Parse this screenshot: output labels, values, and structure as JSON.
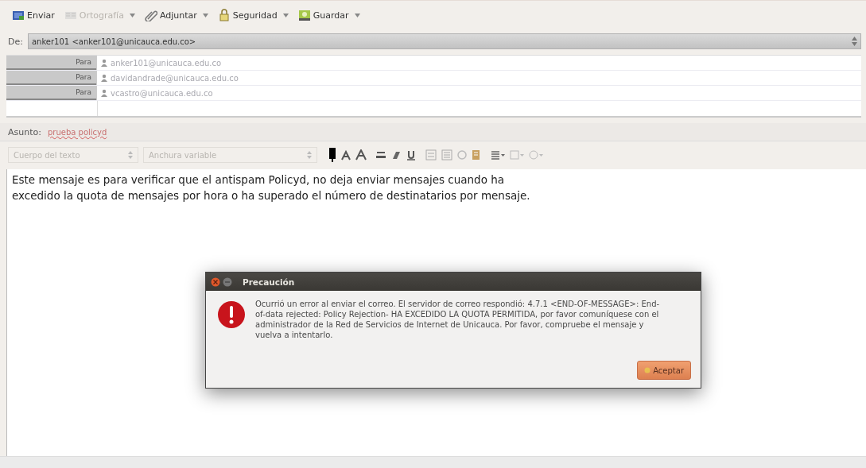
{
  "toolbar": {
    "buttons": [
      {
        "label": "Enviar",
        "disabled": false,
        "dropdown": false
      },
      {
        "label": "Ortografía",
        "disabled": true,
        "dropdown": true
      },
      {
        "label": "Adjuntar",
        "disabled": false,
        "dropdown": true
      },
      {
        "label": "Seguridad",
        "disabled": false,
        "dropdown": true
      },
      {
        "label": "Guardar",
        "disabled": false,
        "dropdown": true
      }
    ]
  },
  "from": {
    "label": "De:",
    "value": "anker101 <anker101@unicauca.edu.co>"
  },
  "recipients": [
    {
      "type": "Para",
      "address": "anker101@unicauca.edu.co"
    },
    {
      "type": "Para",
      "address": "davidandrade@unicauca.edu.co"
    },
    {
      "type": "Para",
      "address": "vcastro@unicauca.edu.co"
    }
  ],
  "subject": {
    "label": "Asunto:",
    "value": "prueba policyd"
  },
  "format_bar": {
    "paragraph_style": "Cuerpo del texto",
    "font": "Anchura variable"
  },
  "body": {
    "lines": [
      "Este mensaje es para verificar que el antispam Policyd, no deja enviar mensajes cuando ha",
      "excedido la quota de mensajes por hora o ha superado el número de destinatarios por mensaje."
    ]
  },
  "dialog": {
    "title": "Precaución",
    "message": "Ocurrió un error al enviar el correo. El servidor de correo respondió: 4.7.1 <END-OF-MESSAGE>: End-of-data rejected: Policy Rejection- HA EXCEDIDO LA QUOTA PERMITIDA, por favor comuníquese con el administrador de la Red de Servicios de Internet de Unicauca. Por favor, compruebe el mensaje y vuelva a intentarlo.",
    "button": "Aceptar"
  }
}
